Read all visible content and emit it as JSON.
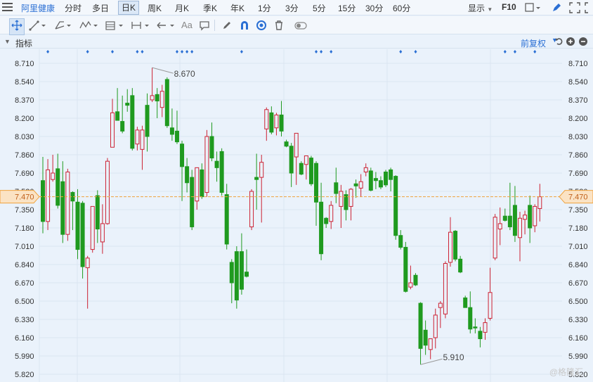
{
  "topbar": {
    "stock_name": "阿里健康",
    "periods": [
      "分时",
      "多日",
      "日K",
      "周K",
      "月K",
      "季K",
      "年K",
      "1分",
      "3分",
      "5分",
      "15分",
      "30分",
      "60分"
    ],
    "active_period": "日K",
    "display_label": "显示",
    "f10_label": "F10"
  },
  "toolbar": {
    "text_tool": "Aa"
  },
  "infobar": {
    "indicator_label": "指标",
    "adjust_label": "前复权"
  },
  "watermark": "@格隆汇",
  "colors": {
    "up": "#cc2233",
    "down": "#1f9a1f",
    "accent": "#2a6fd4",
    "current": "#f0a23c"
  },
  "chart_data": {
    "type": "candlestick",
    "y_ticks": [
      "8.710",
      "8.540",
      "8.370",
      "8.200",
      "8.030",
      "7.860",
      "7.690",
      "7.520",
      "7.350",
      "7.180",
      "7.010",
      "6.840",
      "6.670",
      "6.500",
      "6.330",
      "6.160",
      "5.990",
      "5.820"
    ],
    "ylim": [
      5.82,
      8.71
    ],
    "current_price": "7.470",
    "high_label": "8.670",
    "low_label": "5.910",
    "candles": [
      {
        "o": 7.62,
        "h": 7.84,
        "l": 7.13,
        "c": 7.24
      },
      {
        "o": 7.24,
        "h": 7.82,
        "l": 7.16,
        "c": 7.72
      },
      {
        "o": 7.63,
        "h": 7.86,
        "l": 7.61,
        "c": 7.69
      },
      {
        "o": 7.73,
        "h": 7.87,
        "l": 7.36,
        "c": 7.39
      },
      {
        "o": 7.61,
        "h": 7.8,
        "l": 7.04,
        "c": 7.12
      },
      {
        "o": 7.12,
        "h": 7.73,
        "l": 7.06,
        "c": 7.7
      },
      {
        "o": 7.51,
        "h": 7.52,
        "l": 7.16,
        "c": 7.43
      },
      {
        "o": 7.42,
        "h": 7.54,
        "l": 6.89,
        "c": 6.98
      },
      {
        "o": 7.41,
        "h": 7.43,
        "l": 6.71,
        "c": 6.82
      },
      {
        "o": 6.81,
        "h": 6.92,
        "l": 6.43,
        "c": 6.9
      },
      {
        "o": 6.98,
        "h": 7.38,
        "l": 6.95,
        "c": 7.38
      },
      {
        "o": 7.48,
        "h": 7.53,
        "l": 7.04,
        "c": 7.17
      },
      {
        "o": 7.05,
        "h": 7.4,
        "l": 6.94,
        "c": 7.22
      },
      {
        "o": 7.22,
        "h": 7.83,
        "l": 7.21,
        "c": 7.8
      },
      {
        "o": 7.93,
        "h": 8.38,
        "l": 7.93,
        "c": 8.25
      },
      {
        "o": 8.26,
        "h": 8.48,
        "l": 8.23,
        "c": 8.18
      },
      {
        "o": 8.17,
        "h": 8.41,
        "l": 8.06,
        "c": 8.08
      },
      {
        "o": 8.34,
        "h": 8.47,
        "l": 8.26,
        "c": 8.32
      },
      {
        "o": 8.41,
        "h": 8.48,
        "l": 7.9,
        "c": 7.92
      },
      {
        "o": 7.96,
        "h": 8.12,
        "l": 7.9,
        "c": 8.09
      },
      {
        "o": 7.91,
        "h": 8.13,
        "l": 7.72,
        "c": 8.09
      },
      {
        "o": 8.32,
        "h": 8.43,
        "l": 7.89,
        "c": 8.03
      },
      {
        "o": 8.37,
        "h": 8.67,
        "l": 8.35,
        "c": 8.41
      },
      {
        "o": 8.42,
        "h": 8.48,
        "l": 8.2,
        "c": 8.36
      },
      {
        "o": 8.3,
        "h": 8.51,
        "l": 8.21,
        "c": 8.45
      },
      {
        "o": 8.56,
        "h": 8.58,
        "l": 8.11,
        "c": 8.13
      },
      {
        "o": 8.11,
        "h": 8.29,
        "l": 7.99,
        "c": 8.05
      },
      {
        "o": 8.08,
        "h": 8.27,
        "l": 7.96,
        "c": 7.98
      },
      {
        "o": 7.96,
        "h": 7.99,
        "l": 7.43,
        "c": 7.75
      },
      {
        "o": 7.75,
        "h": 7.83,
        "l": 7.51,
        "c": 7.6
      },
      {
        "o": 7.65,
        "h": 7.72,
        "l": 7.16,
        "c": 7.19
      },
      {
        "o": 7.43,
        "h": 7.73,
        "l": 7.35,
        "c": 7.74
      },
      {
        "o": 7.72,
        "h": 7.78,
        "l": 7.45,
        "c": 7.47
      },
      {
        "o": 7.51,
        "h": 8.09,
        "l": 7.47,
        "c": 8.03
      },
      {
        "o": 8.03,
        "h": 8.16,
        "l": 7.8,
        "c": 7.83
      },
      {
        "o": 7.8,
        "h": 7.89,
        "l": 7.61,
        "c": 7.74
      },
      {
        "o": 7.89,
        "h": 7.92,
        "l": 7.48,
        "c": 7.51
      },
      {
        "o": 7.49,
        "h": 7.59,
        "l": 6.98,
        "c": 7.03
      },
      {
        "o": 6.86,
        "h": 6.89,
        "l": 6.48,
        "c": 6.67
      },
      {
        "o": 6.96,
        "h": 7.01,
        "l": 6.43,
        "c": 6.51
      },
      {
        "o": 6.96,
        "h": 7.13,
        "l": 6.56,
        "c": 6.61
      },
      {
        "o": 6.77,
        "h": 6.98,
        "l": 6.72,
        "c": 6.73
      },
      {
        "o": 7.19,
        "h": 7.54,
        "l": 7.16,
        "c": 7.52
      },
      {
        "o": 7.65,
        "h": 7.87,
        "l": 7.35,
        "c": 7.63
      },
      {
        "o": 7.65,
        "h": 7.86,
        "l": 7.23,
        "c": 7.79
      },
      {
        "o": 8.1,
        "h": 8.3,
        "l": 7.99,
        "c": 8.28
      },
      {
        "o": 8.25,
        "h": 8.31,
        "l": 8.05,
        "c": 8.07
      },
      {
        "o": 8.11,
        "h": 8.25,
        "l": 8.04,
        "c": 8.23
      },
      {
        "o": 8.23,
        "h": 8.36,
        "l": 8.03,
        "c": 8.08
      },
      {
        "o": 7.98,
        "h": 8.0,
        "l": 7.93,
        "c": 7.94
      },
      {
        "o": 7.94,
        "h": 7.97,
        "l": 7.56,
        "c": 7.69
      },
      {
        "o": 7.84,
        "h": 8.03,
        "l": 7.58,
        "c": 8.06
      },
      {
        "o": 7.78,
        "h": 7.8,
        "l": 7.67,
        "c": 7.68
      },
      {
        "o": 7.77,
        "h": 7.85,
        "l": 7.63,
        "c": 7.85
      },
      {
        "o": 7.83,
        "h": 7.85,
        "l": 7.57,
        "c": 7.59
      },
      {
        "o": 7.78,
        "h": 7.8,
        "l": 7.2,
        "c": 7.42
      },
      {
        "o": 7.42,
        "h": 7.6,
        "l": 6.88,
        "c": 6.94
      },
      {
        "o": 7.27,
        "h": 7.28,
        "l": 7.18,
        "c": 7.22
      },
      {
        "o": 7.24,
        "h": 7.43,
        "l": 7.17,
        "c": 7.39
      },
      {
        "o": 7.6,
        "h": 7.74,
        "l": 7.41,
        "c": 7.5
      },
      {
        "o": 7.38,
        "h": 7.58,
        "l": 7.18,
        "c": 7.52
      },
      {
        "o": 7.49,
        "h": 7.53,
        "l": 7.25,
        "c": 7.35
      },
      {
        "o": 7.38,
        "h": 7.55,
        "l": 7.25,
        "c": 7.54
      },
      {
        "o": 7.59,
        "h": 7.63,
        "l": 7.46,
        "c": 7.57
      },
      {
        "o": 7.55,
        "h": 7.68,
        "l": 7.47,
        "c": 7.61
      },
      {
        "o": 7.7,
        "h": 7.78,
        "l": 7.66,
        "c": 7.74
      },
      {
        "o": 7.71,
        "h": 7.74,
        "l": 7.52,
        "c": 7.53
      },
      {
        "o": 7.64,
        "h": 7.7,
        "l": 7.54,
        "c": 7.62
      },
      {
        "o": 7.62,
        "h": 7.66,
        "l": 7.54,
        "c": 7.56
      },
      {
        "o": 7.7,
        "h": 7.72,
        "l": 7.56,
        "c": 7.58
      },
      {
        "o": 7.72,
        "h": 7.74,
        "l": 7.52,
        "c": 7.63
      },
      {
        "o": 7.66,
        "h": 7.67,
        "l": 7.07,
        "c": 7.11
      },
      {
        "o": 7.11,
        "h": 7.16,
        "l": 6.98,
        "c": 7.0
      },
      {
        "o": 7.0,
        "h": 7.05,
        "l": 6.58,
        "c": 6.59
      },
      {
        "o": 6.63,
        "h": 6.83,
        "l": 6.61,
        "c": 6.67
      },
      {
        "o": 6.74,
        "h": 6.76,
        "l": 6.64,
        "c": 6.65
      },
      {
        "o": 6.48,
        "h": 6.49,
        "l": 5.91,
        "c": 6.06
      },
      {
        "o": 6.23,
        "h": 6.32,
        "l": 6.0,
        "c": 6.09
      },
      {
        "o": 6.05,
        "h": 6.13,
        "l": 5.96,
        "c": 6.15
      },
      {
        "o": 6.16,
        "h": 6.43,
        "l": 6.06,
        "c": 6.37
      },
      {
        "o": 6.44,
        "h": 6.5,
        "l": 6.25,
        "c": 6.48
      },
      {
        "o": 6.38,
        "h": 6.87,
        "l": 6.34,
        "c": 6.85
      },
      {
        "o": 6.86,
        "h": 7.28,
        "l": 6.82,
        "c": 7.14
      },
      {
        "o": 7.15,
        "h": 7.16,
        "l": 6.87,
        "c": 6.89
      },
      {
        "o": 6.89,
        "h": 6.92,
        "l": 6.76,
        "c": 6.77
      },
      {
        "o": 6.53,
        "h": 6.55,
        "l": 6.44,
        "c": 6.44
      },
      {
        "o": 6.44,
        "h": 6.59,
        "l": 6.2,
        "c": 6.24
      },
      {
        "o": 6.26,
        "h": 6.34,
        "l": 6.2,
        "c": 6.25
      },
      {
        "o": 6.22,
        "h": 6.26,
        "l": 6.07,
        "c": 6.15
      },
      {
        "o": 6.21,
        "h": 6.34,
        "l": 6.14,
        "c": 6.3
      },
      {
        "o": 6.34,
        "h": 6.81,
        "l": 6.32,
        "c": 6.58
      },
      {
        "o": 6.9,
        "h": 7.31,
        "l": 6.88,
        "c": 7.28
      },
      {
        "o": 7.17,
        "h": 7.37,
        "l": 7.02,
        "c": 7.22
      },
      {
        "o": 7.29,
        "h": 7.36,
        "l": 7.24,
        "c": 7.25
      },
      {
        "o": 7.29,
        "h": 7.6,
        "l": 7.16,
        "c": 7.19
      },
      {
        "o": 7.39,
        "h": 7.57,
        "l": 7.05,
        "c": 7.11
      },
      {
        "o": 7.09,
        "h": 7.33,
        "l": 6.87,
        "c": 7.27
      },
      {
        "o": 7.26,
        "h": 7.34,
        "l": 7.12,
        "c": 7.3
      },
      {
        "o": 7.39,
        "h": 7.48,
        "l": 7.04,
        "c": 7.18
      },
      {
        "o": 7.2,
        "h": 7.4,
        "l": 7.14,
        "c": 7.38
      },
      {
        "o": 7.36,
        "h": 7.59,
        "l": 7.24,
        "c": 7.47
      }
    ],
    "event_marker_indices": [
      1,
      9,
      14,
      19,
      20,
      27,
      28,
      29,
      30,
      40,
      55,
      56,
      58,
      72,
      75,
      93,
      95,
      99
    ]
  }
}
